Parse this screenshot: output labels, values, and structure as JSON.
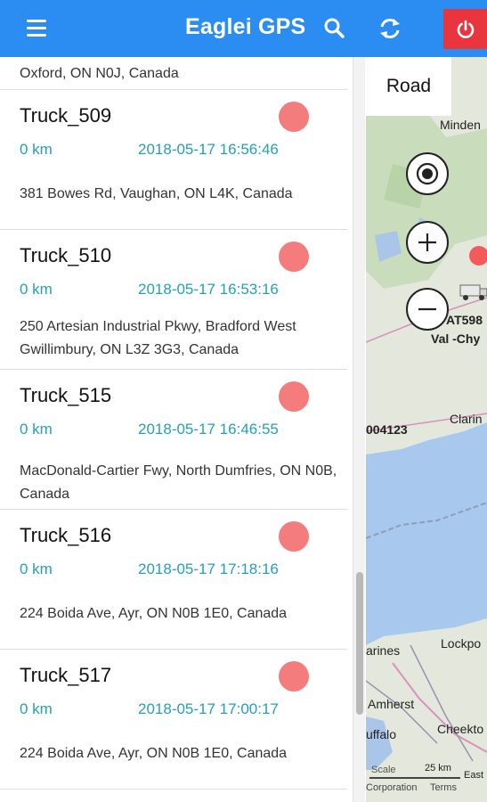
{
  "header": {
    "title": "Eaglei GPS",
    "menu_icon": "hamburger-icon",
    "search_icon": "search-icon",
    "refresh_icon": "refresh-icon",
    "power_icon": "power-icon",
    "brand_color": "#2b8cf2",
    "power_color": "#e8353e"
  },
  "list": {
    "partial_address": "Oxford, ON N0J, Canada",
    "items": [
      {
        "name": "Truck_509",
        "distance": "0 km",
        "timestamp": "2018-05-17 16:56:46",
        "address": "381 Bowes Rd, Vaughan, ON L4K, Canada"
      },
      {
        "name": "Truck_510",
        "distance": "0 km",
        "timestamp": "2018-05-17 16:53:16",
        "address": "250 Artesian Industrial Pkwy, Bradford West Gwillimbury, ON L3Z 3G3, Canada"
      },
      {
        "name": "Truck_515",
        "distance": "0 km",
        "timestamp": "2018-05-17 16:46:55",
        "address": "MacDonald-Cartier Fwy, North Dumfries, ON N0B, Canada"
      },
      {
        "name": "Truck_516",
        "distance": "0 km",
        "timestamp": "2018-05-17 17:18:16",
        "address": "224 Boida Ave, Ayr, ON N0B 1E0, Canada"
      },
      {
        "name": "Truck_517",
        "distance": "0 km",
        "timestamp": "2018-05-17 17:00:17",
        "address": "224 Boida Ave, Ayr, ON N0B 1E0, Canada"
      }
    ],
    "status_color": "#f47c7c",
    "accent_color": "#24a0b8"
  },
  "map": {
    "layer_button": "Road",
    "controls": [
      "locate-icon",
      "zoom-in-icon",
      "zoom-out-icon"
    ],
    "labels": {
      "minden": "Minden",
      "at598": "AT598",
      "val_chy": "Val -Chy",
      "id_004123": "004123",
      "clarin": "Clarin",
      "lockpo": "Lockpo",
      "arines": "arines",
      "amherst": "Amherst",
      "uffalo": "uffalo",
      "cheekto": "Cheekto",
      "scale_mi": "Scale",
      "scale_km": "25 km",
      "east": "East",
      "corporation": "Corporation",
      "terms": "Terms"
    }
  }
}
